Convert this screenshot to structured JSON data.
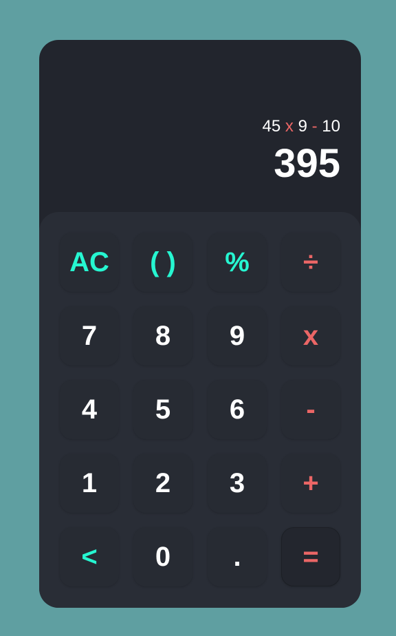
{
  "display": {
    "expression": {
      "a": "45",
      "op1": "x",
      "b": "9",
      "op2": "-",
      "c": "10"
    },
    "result": "395"
  },
  "keys": {
    "ac": "AC",
    "parens": "( )",
    "percent": "%",
    "divide": "÷",
    "seven": "7",
    "eight": "8",
    "nine": "9",
    "multiply": "x",
    "four": "4",
    "five": "5",
    "six": "6",
    "minus": "-",
    "one": "1",
    "two": "2",
    "three": "3",
    "plus": "+",
    "backspace": "<",
    "zero": "0",
    "decimal": ".",
    "equals": "="
  },
  "colors": {
    "background": "#5f9fa1",
    "body": "#22252d",
    "keypad": "#292d36",
    "function_keys": "#26f6d1",
    "operator_keys": "#eb6666",
    "text": "#ffffff"
  }
}
